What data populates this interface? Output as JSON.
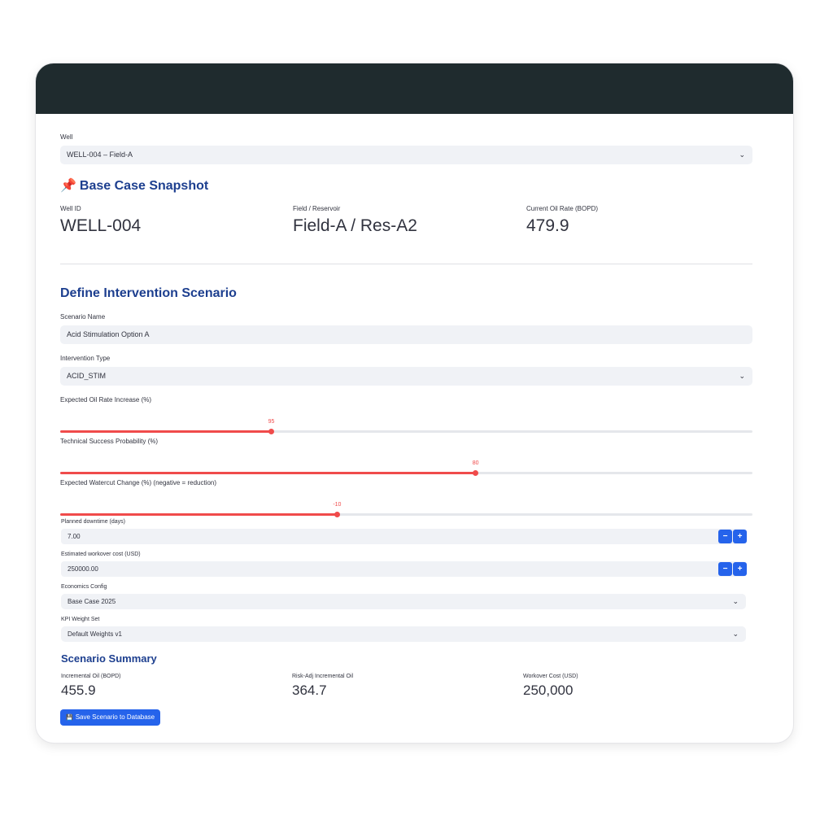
{
  "well": {
    "label": "Well",
    "selected": "WELL-004 – Field-A"
  },
  "base_case": {
    "icon": "📌",
    "title": "Base Case Snapshot",
    "metrics": [
      {
        "label": "Well ID",
        "value": "WELL-004"
      },
      {
        "label": "Field / Reservoir",
        "value": "Field-A / Res-A2"
      },
      {
        "label": "Current Oil Rate (BOPD)",
        "value": "479.9"
      }
    ]
  },
  "scenario": {
    "title": "Define Intervention Scenario",
    "name_label": "Scenario Name",
    "name_value": "Acid Stimulation Option A",
    "type_label": "Intervention Type",
    "type_value": "ACID_STIM",
    "sliders": [
      {
        "label": "Expected Oil Rate Increase (%)",
        "value": "95",
        "fraction": 0.305
      },
      {
        "label": "Technical Success Probability (%)",
        "value": "80",
        "fraction": 0.6
      },
      {
        "label": "Expected Watercut Change (%) (negative = reduction)",
        "value": "-10",
        "fraction": 0.4
      }
    ],
    "downtime_label": "Planned downtime (days)",
    "downtime_value": "7.00",
    "cost_label": "Estimated workover cost (USD)",
    "cost_value": "250000.00",
    "minus": "−",
    "plus": "+",
    "econ_label": "Economics Config",
    "econ_value": "Base Case 2025",
    "kpi_label": "KPI Weight Set",
    "kpi_value": "Default Weights v1"
  },
  "summary": {
    "title": "Scenario Summary",
    "metrics": [
      {
        "label": "Incremental Oil (BOPD)",
        "value": "455.9"
      },
      {
        "label": "Risk-Adj Incremental Oil",
        "value": "364.7"
      },
      {
        "label": "Workover Cost (USD)",
        "value": "250,000"
      }
    ],
    "save_icon": "💾",
    "save_label": "Save Scenario to Database"
  },
  "colors": {
    "accent": "#2563eb",
    "slider": "#f04b4b",
    "heading": "#1d3f8f",
    "topbar": "#1f2b2e"
  }
}
